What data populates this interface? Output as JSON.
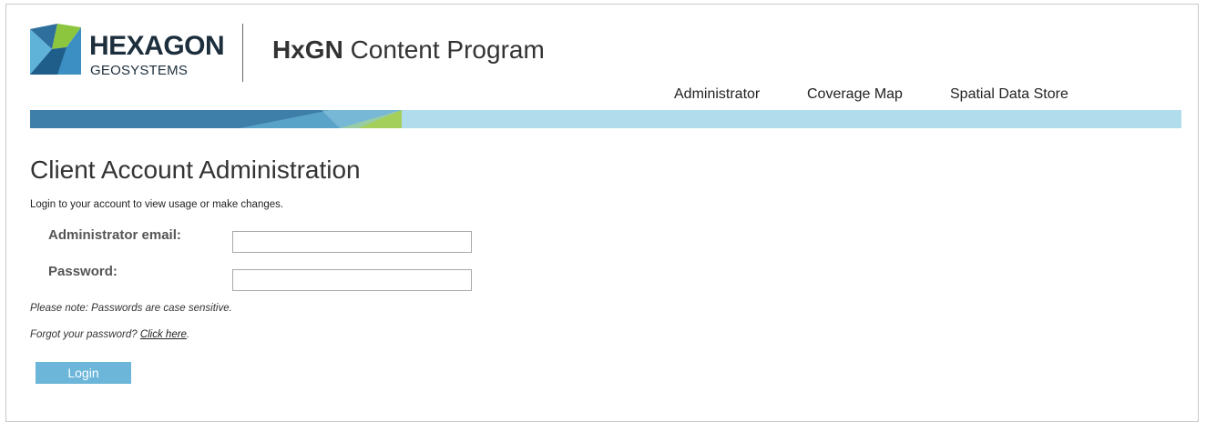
{
  "logo": {
    "brand": "HEXAGON",
    "sub": "GEOSYSTEMS"
  },
  "header": {
    "program_bold": "HxGN",
    "program_rest": " Content Program"
  },
  "nav": {
    "items": [
      {
        "label": "Administrator"
      },
      {
        "label": "Coverage Map"
      },
      {
        "label": "Spatial Data Store"
      }
    ]
  },
  "main": {
    "heading": "Client Account Administration",
    "subtext": "Login to your account to view usage or make changes.",
    "email_label": "Administrator email:",
    "email_value": "",
    "password_label": "Password:",
    "password_value": "",
    "note_case": "Please note: Passwords are case sensitive.",
    "forgot_prefix": "Forgot your password? ",
    "forgot_link": "Click here",
    "forgot_suffix": ".",
    "login_label": "Login"
  },
  "colors": {
    "banner_dark": "#3d7fa8",
    "banner_mid": "#5aa3c8",
    "banner_green": "#a4cf5a",
    "banner_light": "#b0dcec",
    "login_button": "#6bb6d9"
  }
}
